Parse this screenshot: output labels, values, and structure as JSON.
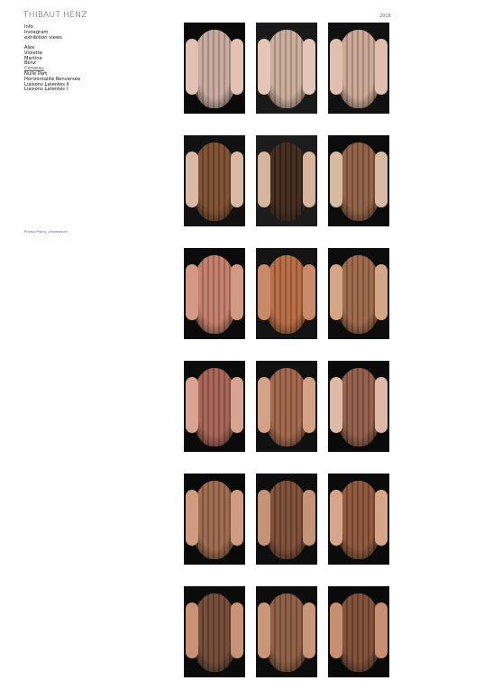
{
  "site": {
    "title": "THIBAUT HENZ",
    "year": "2018"
  },
  "nav": {
    "top": [
      "Info",
      "Instagram",
      "exhibition views"
    ],
    "projects": [
      "Alex",
      "Violette",
      "Martine",
      "Benz",
      "Cerveau",
      "Nulle Part",
      "Horizontalité Renversée",
      "Liaisons Latentes II",
      "Liaisons Latentes I"
    ],
    "current": "Cerveau"
  },
  "footer": {
    "privacy": "Privacy Policy",
    "sep": " | ",
    "imprint": "Impressum"
  },
  "gallery": {
    "rows": [
      [
        {
          "skin": "#c7a79c",
          "bg": "#0a0a0a",
          "hand": "#e2c1b3"
        },
        {
          "skin": "#c9aa98",
          "bg": "#1a1a1a",
          "hand": "#e3c6b6"
        },
        {
          "skin": "#caa591",
          "bg": "#111111",
          "hand": "#e0bfae"
        }
      ],
      [
        {
          "skin": "#7a4b2c",
          "bg": "#111111",
          "hand": "#d9b8a4"
        },
        {
          "skin": "#3e2418",
          "bg": "#1c1c1c",
          "hand": "#d7b49c"
        },
        {
          "skin": "#8c5c3f",
          "bg": "#0c0c0c",
          "hand": "#d8b9a2"
        }
      ],
      [
        {
          "skin": "#c07a66",
          "bg": "#0b0b0b",
          "hand": "#d39984"
        },
        {
          "skin": "#b5683f",
          "bg": "#141414",
          "hand": "#c98a69"
        },
        {
          "skin": "#9b6446",
          "bg": "#0d0d0d",
          "hand": "#d5a588"
        }
      ],
      [
        {
          "skin": "#a35f52",
          "bg": "#0b0b0b",
          "hand": "#d8a38f"
        },
        {
          "skin": "#9e6246",
          "bg": "#101010",
          "hand": "#d3a287"
        },
        {
          "skin": "#8e5a45",
          "bg": "#0a0a0a",
          "hand": "#ddb9a6"
        }
      ],
      [
        {
          "skin": "#9a6548",
          "bg": "#0a0a0a",
          "hand": "#cf9c82"
        },
        {
          "skin": "#7a4a32",
          "bg": "#0e0e0e",
          "hand": "#c59476"
        },
        {
          "skin": "#8a5237",
          "bg": "#0b0b0b",
          "hand": "#d7a58a"
        }
      ],
      [
        {
          "skin": "#6e4632",
          "bg": "#0b0b0b",
          "hand": "#c89276"
        },
        {
          "skin": "#8a5a3f",
          "bg": "#0d0d0d",
          "hand": "#c99679"
        },
        {
          "skin": "#7b4a33",
          "bg": "#0a0a0a",
          "hand": "#c78e72"
        }
      ]
    ]
  }
}
